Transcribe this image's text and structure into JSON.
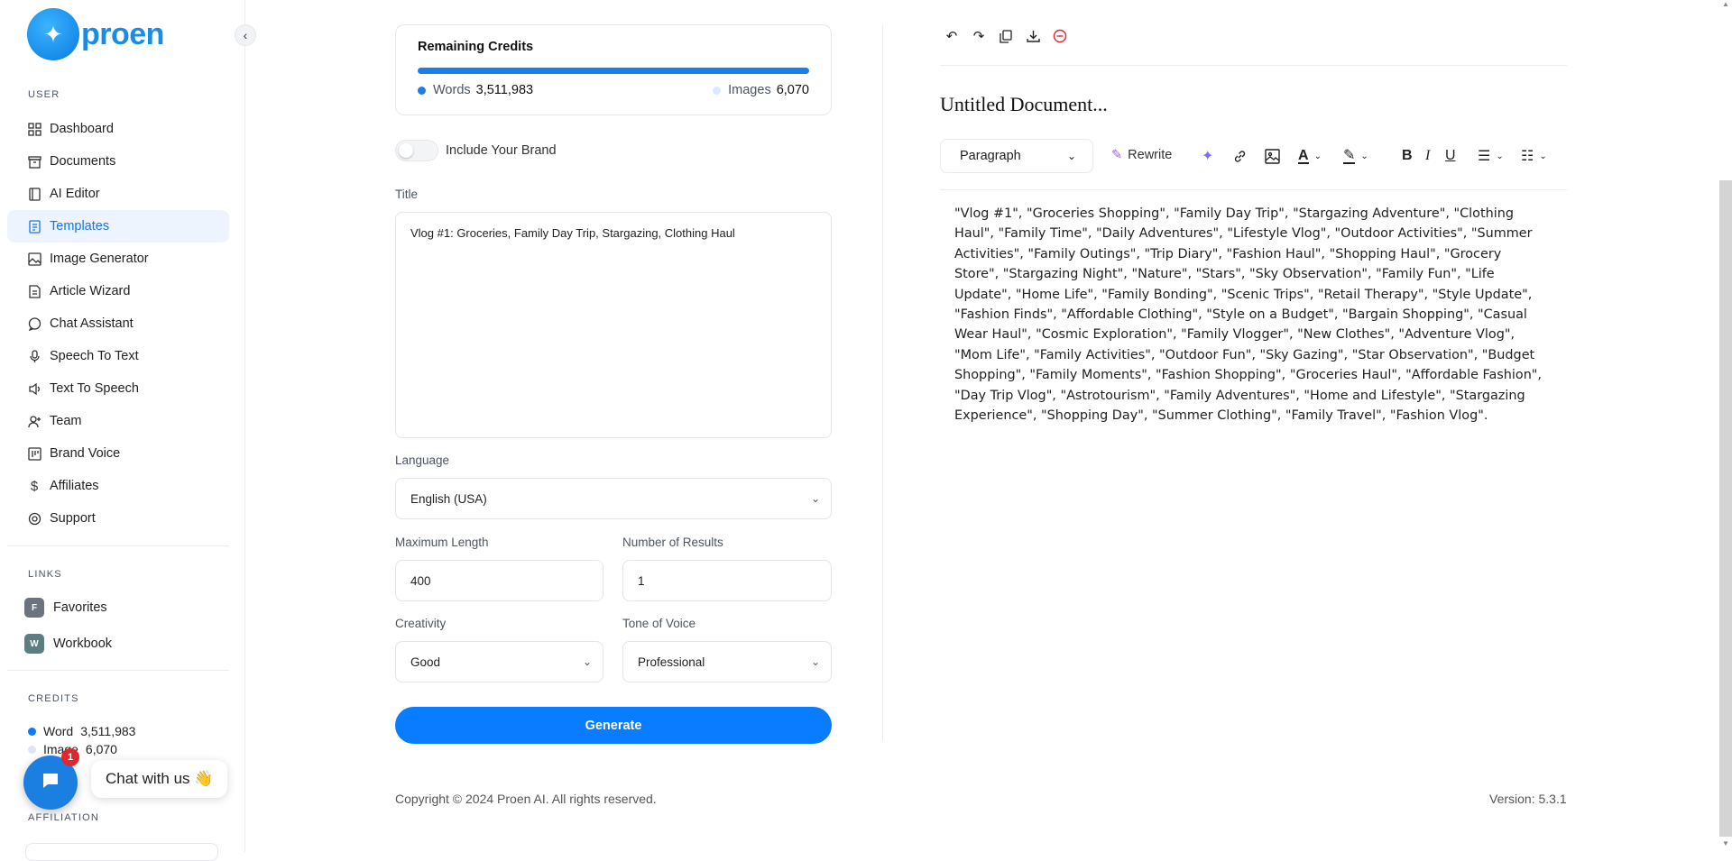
{
  "brand": {
    "name": "proen"
  },
  "sidebar": {
    "user_label": "USER",
    "items": [
      {
        "label": "Dashboard",
        "icon": "grid-icon"
      },
      {
        "label": "Documents",
        "icon": "archive-icon"
      },
      {
        "label": "AI Editor",
        "icon": "notebook-icon"
      },
      {
        "label": "Templates",
        "icon": "file-text-icon",
        "active": true
      },
      {
        "label": "Image Generator",
        "icon": "image-icon"
      },
      {
        "label": "Article Wizard",
        "icon": "article-icon"
      },
      {
        "label": "Chat Assistant",
        "icon": "chat-icon"
      },
      {
        "label": "Speech To Text",
        "icon": "mic-icon"
      },
      {
        "label": "Text To Speech",
        "icon": "speaker-icon"
      },
      {
        "label": "Team",
        "icon": "user-plus-icon"
      },
      {
        "label": "Brand Voice",
        "icon": "brand-icon"
      },
      {
        "label": "Affiliates",
        "icon": "dollar-icon"
      },
      {
        "label": "Support",
        "icon": "lifebuoy-icon"
      }
    ],
    "links_label": "LINKS",
    "links": [
      {
        "badge": "F",
        "label": "Favorites",
        "color": "#6b7280"
      },
      {
        "badge": "W",
        "label": "Workbook",
        "color": "#5b7f80"
      }
    ],
    "credits_label": "CREDITS",
    "credits": {
      "word_label": "Word",
      "word_value": "3,511,983",
      "image_label": "Image",
      "image_value": "6,070"
    },
    "affiliation_label": "AFFILIATION"
  },
  "chat_widget": {
    "badge_count": "1",
    "bubble_text": "Chat with us 👋"
  },
  "credits_card": {
    "title": "Remaining Credits",
    "words_label": "Words",
    "words_value": "3,511,983",
    "images_label": "Images",
    "images_value": "6,070",
    "words_fraction": 1.0
  },
  "form": {
    "include_brand_label": "Include Your Brand",
    "title_label": "Title",
    "title_value": "Vlog #1: Groceries, Family Day Trip, Stargazing, Clothing Haul",
    "language_label": "Language",
    "language_value": "English (USA)",
    "max_length_label": "Maximum Length",
    "max_length_value": "400",
    "num_results_label": "Number of Results",
    "num_results_value": "1",
    "creativity_label": "Creativity",
    "creativity_value": "Good",
    "tone_label": "Tone of Voice",
    "tone_value": "Professional",
    "generate_label": "Generate"
  },
  "editor": {
    "doc_title": "Untitled Document...",
    "paragraph_select": "Paragraph",
    "rewrite_label": "Rewrite",
    "content": "\"Vlog #1\", \"Groceries Shopping\", \"Family Day Trip\", \"Stargazing Adventure\", \"Clothing Haul\", \"Family Time\", \"Daily Adventures\", \"Lifestyle Vlog\", \"Outdoor Activities\", \"Summer Activities\", \"Family Outings\", \"Trip Diary\", \"Fashion Haul\", \"Shopping Haul\", \"Grocery Store\", \"Stargazing Night\", \"Nature\", \"Stars\", \"Sky Observation\", \"Family Fun\", \"Life Update\", \"Home Life\", \"Family Bonding\", \"Scenic Trips\", \"Retail Therapy\", \"Style Update\", \"Fashion Finds\", \"Affordable Clothing\", \"Style on a Budget\", \"Bargain Shopping\", \"Casual Wear Haul\", \"Cosmic Exploration\", \"Family Vlogger\", \"New Clothes\", \"Adventure Vlog\", \"Mom Life\", \"Family Activities\", \"Outdoor Fun\", \"Sky Gazing\", \"Star Observation\", \"Budget Shopping\", \"Family Moments\", \"Fashion Shopping\", \"Groceries Haul\", \"Affordable Fashion\", \"Day Trip Vlog\", \"Astrotourism\", \"Family Adventures\", \"Home and Lifestyle\", \"Stargazing Experience\", \"Shopping Day\", \"Summer Clothing\", \"Family Travel\", \"Fashion Vlog\"."
  },
  "footer": {
    "copyright": "Copyright © 2024 Proen AI. All rights reserved.",
    "version": "Version: 5.3.1"
  },
  "colors": {
    "accent": "#0a7cff",
    "active_bg": "#eef4fd",
    "danger": "#e0262f"
  }
}
